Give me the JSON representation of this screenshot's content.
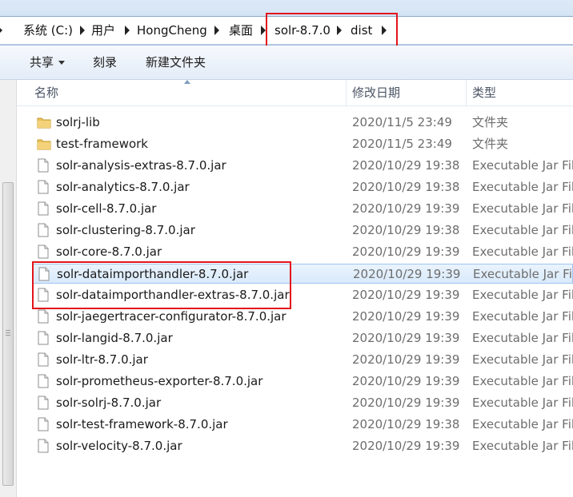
{
  "breadcrumb": {
    "items": [
      "系统 (C:)",
      "用户",
      "HongCheng",
      "桌面",
      "solr-8.7.0",
      "dist"
    ]
  },
  "toolbar": {
    "share_label": "共享",
    "burn_label": "刻录",
    "new_folder_label": "新建文件夹"
  },
  "columns": {
    "name": "名称",
    "date": "修改日期",
    "type": "类型"
  },
  "files": [
    {
      "name": "solrj-lib",
      "date": "2020/11/5 23:49",
      "type": "文件夹",
      "icon": "folder-icon"
    },
    {
      "name": "test-framework",
      "date": "2020/11/5 23:49",
      "type": "文件夹",
      "icon": "folder-icon"
    },
    {
      "name": "solr-analysis-extras-8.7.0.jar",
      "date": "2020/10/29 19:38",
      "type": "Executable Jar File",
      "icon": "jar-file-icon"
    },
    {
      "name": "solr-analytics-8.7.0.jar",
      "date": "2020/10/29 19:38",
      "type": "Executable Jar File",
      "icon": "jar-file-icon"
    },
    {
      "name": "solr-cell-8.7.0.jar",
      "date": "2020/10/29 19:39",
      "type": "Executable Jar File",
      "icon": "jar-file-icon"
    },
    {
      "name": "solr-clustering-8.7.0.jar",
      "date": "2020/10/29 19:38",
      "type": "Executable Jar File",
      "icon": "jar-file-icon"
    },
    {
      "name": "solr-core-8.7.0.jar",
      "date": "2020/10/29 19:39",
      "type": "Executable Jar File",
      "icon": "jar-file-icon"
    },
    {
      "name": "solr-dataimporthandler-8.7.0.jar",
      "date": "2020/10/29 19:39",
      "type": "Executable Jar File",
      "icon": "jar-file-icon",
      "selected": true
    },
    {
      "name": "solr-dataimporthandler-extras-8.7.0.jar",
      "date": "2020/10/29 19:39",
      "type": "Executable Jar File",
      "icon": "jar-file-icon"
    },
    {
      "name": "solr-jaegertracer-configurator-8.7.0.jar",
      "date": "2020/10/29 19:39",
      "type": "Executable Jar File",
      "icon": "jar-file-icon"
    },
    {
      "name": "solr-langid-8.7.0.jar",
      "date": "2020/10/29 19:39",
      "type": "Executable Jar File",
      "icon": "jar-file-icon"
    },
    {
      "name": "solr-ltr-8.7.0.jar",
      "date": "2020/10/29 19:39",
      "type": "Executable Jar File",
      "icon": "jar-file-icon"
    },
    {
      "name": "solr-prometheus-exporter-8.7.0.jar",
      "date": "2020/10/29 19:39",
      "type": "Executable Jar File",
      "icon": "jar-file-icon"
    },
    {
      "name": "solr-solrj-8.7.0.jar",
      "date": "2020/10/29 19:39",
      "type": "Executable Jar File",
      "icon": "jar-file-icon"
    },
    {
      "name": "solr-test-framework-8.7.0.jar",
      "date": "2020/10/29 19:38",
      "type": "Executable Jar File",
      "icon": "jar-file-icon"
    },
    {
      "name": "solr-velocity-8.7.0.jar",
      "date": "2020/10/29 19:39",
      "type": "Executable Jar File",
      "icon": "jar-file-icon"
    }
  ],
  "colors": {
    "highlight_box": "#e3141b",
    "selection": "#d9eafb"
  }
}
